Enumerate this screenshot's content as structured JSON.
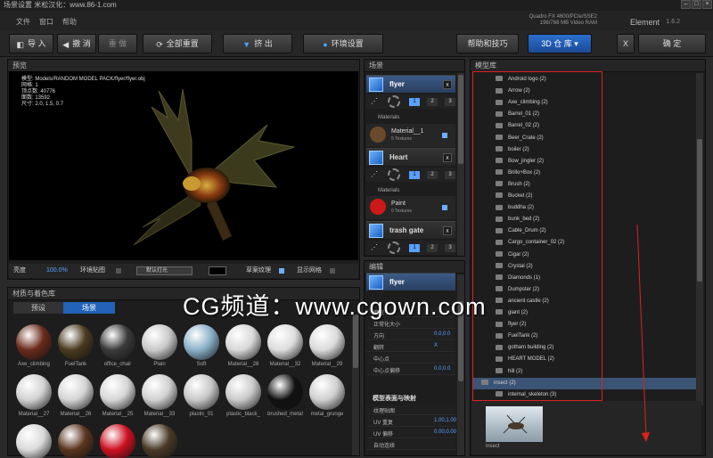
{
  "window": {
    "title": "场景设置 米松汉化：www.86-1.com",
    "gpu_line1": "Quadro FX 4600/PCIe/SSE2",
    "gpu_line2": "196/768 MB Video RAM",
    "app_name": "Element",
    "version": "1.6.2"
  },
  "menu": [
    "文件",
    "窗口",
    "帮助"
  ],
  "toolbar": {
    "import": "导 入",
    "undo": "撤 消",
    "redo": "重 做",
    "reset_all": "全部重置",
    "extrude": "挤 出",
    "env_settings": "环境设置",
    "help_tips": "帮助和技巧",
    "repo_3d": "3D 仓 库",
    "x": "X",
    "confirm": "确 定"
  },
  "preview": {
    "title": "预览",
    "info": [
      "模型: Models/RANDOM MODEL PACK/flyer/flyer.obj",
      "网格: 1",
      "顶点数: 40776",
      "面数: 13592",
      "尺寸: 2.0, 1.5, 0.7"
    ],
    "brightness_label": "亮度",
    "brightness_value": "100.0%",
    "env_map_label": "环境贴图",
    "default_light": "默认灯光",
    "draft_texture": "草案纹理",
    "show_grid": "显示网格"
  },
  "materials": {
    "title": "材质与着色库",
    "tab_presets": "预设",
    "tab_scene": "场景",
    "items": [
      {
        "name": "Axe_climbing",
        "color": "#6a2a1a"
      },
      {
        "name": "FuelTank",
        "color": "#4a3a20"
      },
      {
        "name": "office_chair",
        "color": "#3a3a3a"
      },
      {
        "name": "Plain",
        "color": "#c9c9c9"
      },
      {
        "name": "Soft",
        "color": "#8ab0c8"
      },
      {
        "name": "Material__28",
        "color": "#d8d8d8"
      },
      {
        "name": "Material__32",
        "color": "#dcdcdc"
      },
      {
        "name": "Material__29",
        "color": "#dadada"
      },
      {
        "name": "Material__27",
        "color": "#d2d2d2"
      },
      {
        "name": "Material__26",
        "color": "#d4d4d4"
      },
      {
        "name": "Material__25",
        "color": "#d6d6d6"
      },
      {
        "name": "Material__33",
        "color": "#d0d0d0"
      },
      {
        "name": "plastic_01",
        "color": "#c8c8c8"
      },
      {
        "name": "plastic_black_",
        "color": "#cacaca"
      },
      {
        "name": "brushed_metal",
        "color": "#111111"
      },
      {
        "name": "metal_grunge",
        "color": "#cfcfcf"
      },
      {
        "name": "",
        "color": "#d9d9d9"
      },
      {
        "name": "",
        "color": "#5a3520"
      },
      {
        "name": "",
        "color": "#cc1020"
      },
      {
        "name": "",
        "color": "#4a3a28"
      }
    ]
  },
  "scene": {
    "title": "场景",
    "objects": [
      {
        "name": "flyer",
        "material_name": "Material__1",
        "material_sub": "5 Textures",
        "material_color": "#6a4a2a"
      },
      {
        "name": "Heart",
        "material_name": "Paint",
        "material_sub": "0 Textures",
        "material_color": "#cc1818"
      },
      {
        "name": "trash gate"
      }
    ],
    "materials_header": "Materials",
    "seg": [
      "1",
      "2",
      "3"
    ]
  },
  "editor": {
    "title": "编辑",
    "object": "flyer",
    "rows": [
      {
        "label": "缩放",
        "value": ""
      },
      {
        "label": "正常化大小",
        "value": ""
      },
      {
        "label": "方向",
        "value": "0.0,0.0"
      },
      {
        "label": "翻转",
        "value": "X"
      },
      {
        "label": "中心点",
        "value": ""
      },
      {
        "label": "中心点偏移",
        "value": "0.0,0.0"
      }
    ],
    "section2": "模型表面与映射",
    "rows2": [
      {
        "label": "纹理贴图",
        "value": ""
      },
      {
        "label": "UV 重复",
        "value": "1.00,1.00"
      },
      {
        "label": "UV 偏移",
        "value": "0.00,0.00"
      },
      {
        "label": "自动连续",
        "value": ""
      }
    ]
  },
  "model_browser": {
    "title": "模型库",
    "items": [
      "Android logo (2)",
      "Arrow (2)",
      "Axe_climbing (2)",
      "Barrel_01 (2)",
      "Barrel_02 (2)",
      "Beer_Crate (2)",
      "boiler (2)",
      "Bow_jingler (2)",
      "Brillo+Box (2)",
      "Brush (2)",
      "Bucket (2)",
      "buddha (2)",
      "bunk_bed (2)",
      "Cable_Drum (2)",
      "Cargo_container_02 (2)",
      "Cigar (2)",
      "Crystal (2)",
      "Diamonds (1)",
      "Dumpster (2)",
      "ancient castle (2)",
      "giant (2)",
      "flyer (2)",
      "FuelTank (2)",
      "gotham building (2)",
      "HEART MODEL (2)",
      "hill (2)",
      "insect (2)",
      "internal_skeleton (3)"
    ],
    "selected_index": 26,
    "preview_label": "insect"
  },
  "watermark": "CG频道：www.cgown.com"
}
